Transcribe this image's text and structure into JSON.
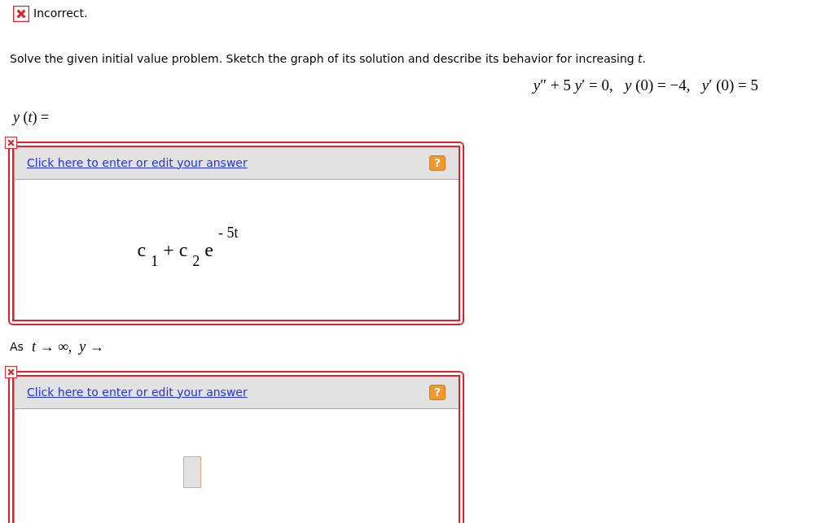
{
  "result": {
    "status": "Incorrect.",
    "correct": false
  },
  "question": "Solve the given initial value problem. Sketch the graph of its solution and describe its behavior for increasing *t*.",
  "equation": "*y*″ + 5 *y*′ = 0,   *y* (0) = −4,   *y*′ (0) = 5",
  "parts": [
    {
      "math": "*y* (*t*) =",
      "correct": false,
      "link": "Click here to enter or edit your answer",
      "help": "?",
      "answer": {
        "kind": "expression",
        "value": "c $_{1}$ + c $_{2}$ e $^{- 5t}$"
      }
    },
    {
      "prefix": "As",
      "math": "*t* → ∞,  *y* →",
      "correct": false,
      "link": "Click here to enter or edit your answer",
      "help": "?",
      "answer": {
        "kind": "empty"
      }
    }
  ]
}
